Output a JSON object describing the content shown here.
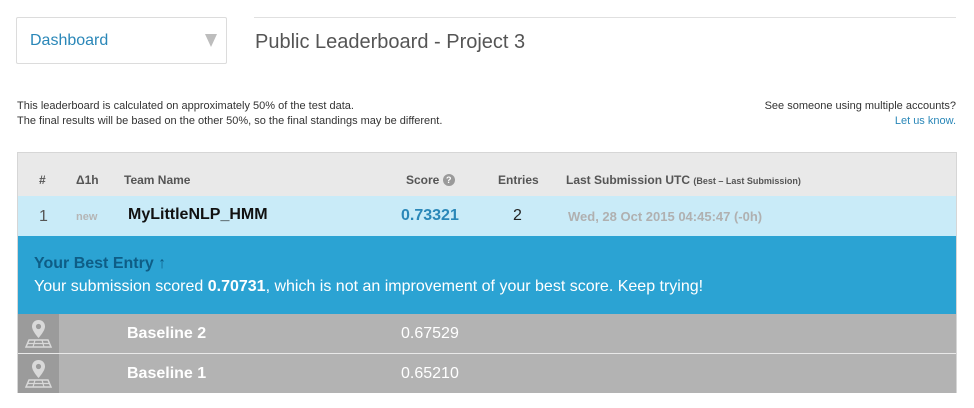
{
  "dashboard": {
    "label": "Dashboard"
  },
  "page": {
    "title": "Public Leaderboard - Project 3"
  },
  "notes": {
    "left_line1": "This leaderboard is calculated on approximately 50% of the test data.",
    "left_line2": "The final results will be based on the other 50%, so the final standings may be different.",
    "right_line1": "See someone using multiple accounts?",
    "right_link": "Let us know."
  },
  "table": {
    "headers": {
      "rank": "#",
      "delta": "Δ1h",
      "team": "Team Name",
      "score": "Score",
      "help": "?",
      "entries": "Entries",
      "last": "Last Submission UTC",
      "last_sub": "(Best – Last Submission)"
    },
    "my_row": {
      "rank": "1",
      "delta": "new",
      "team": "MyLittleNLP_HMM",
      "score": "0.73321",
      "entries": "2",
      "last": "Wed, 28 Oct 2015 04:45:47 (-0h)"
    },
    "best_entry": {
      "heading": "Your Best Entry ↑",
      "msg_prefix": "Your submission scored ",
      "msg_score": "0.70731",
      "msg_suffix": ", which is not an improvement of your best score. Keep trying!"
    },
    "baselines": [
      {
        "name": "Baseline 2",
        "score": "0.67529",
        "icon": "map-pin-icon"
      },
      {
        "name": "Baseline 1",
        "score": "0.65210",
        "icon": "map-pin-icon"
      }
    ]
  },
  "colors": {
    "accent": "#2ba3d3",
    "highlight_row": "#c9ebf8",
    "baseline_row": "#b3b3b3",
    "link": "#2a87b8"
  }
}
